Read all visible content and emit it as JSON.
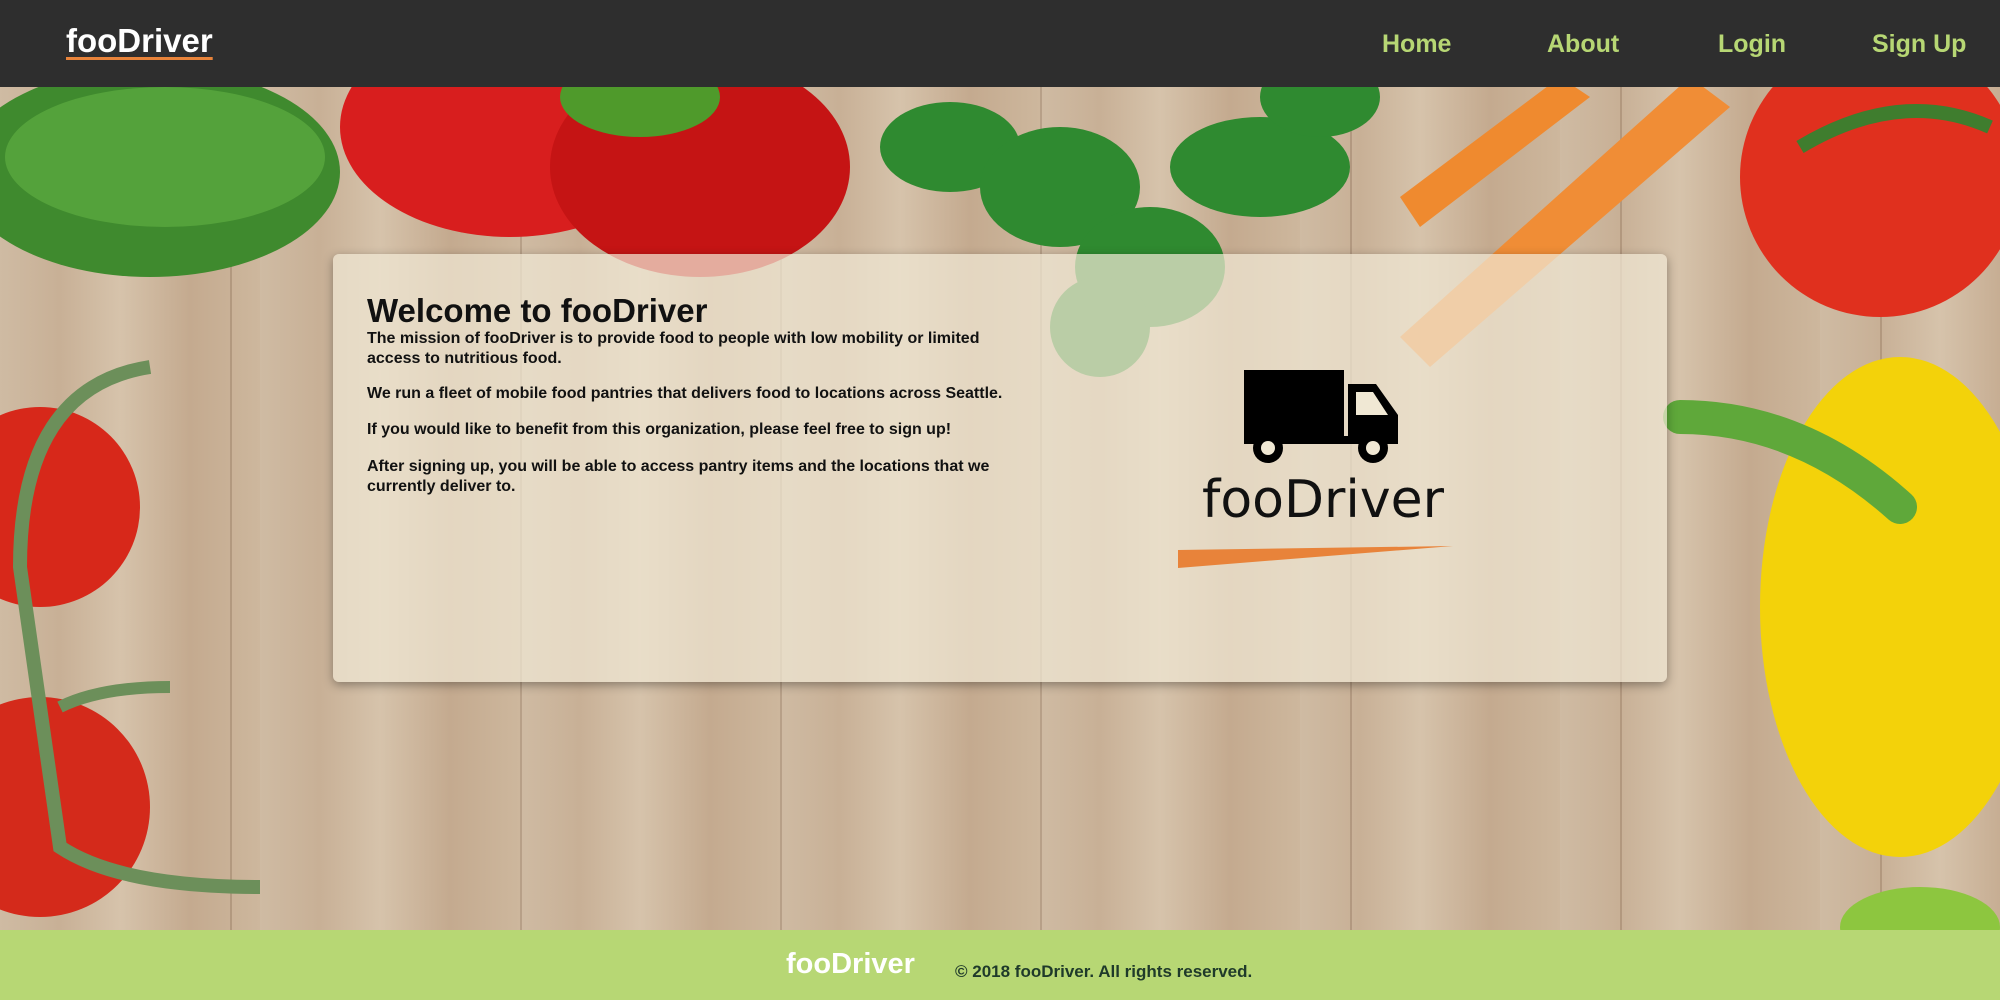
{
  "header": {
    "brand": "fooDriver",
    "nav": {
      "home": "Home",
      "about": "About",
      "login": "Login",
      "signup": "Sign Up"
    }
  },
  "main": {
    "title": "Welcome to fooDriver",
    "paragraphs": [
      "The mission of fooDriver is to provide food to people with low mobility or limited access to nutritious food.",
      "We run a fleet of mobile food pantries that delivers food to locations across Seattle.",
      "If you would like to benefit from this organization, please feel free to sign up!",
      "After signing up, you will be able to access pantry items and the locations that we currently deliver to."
    ],
    "logo_text": "fooDriver"
  },
  "footer": {
    "brand": "fooDriver",
    "copyright": "© 2018 fooDriver. All rights reserved."
  },
  "colors": {
    "header_bg": "#2e2e2e",
    "nav_text": "#b7d774",
    "accent_orange": "#e8833a",
    "footer_bg": "#b7d774"
  },
  "icons": [
    "truck-icon"
  ]
}
